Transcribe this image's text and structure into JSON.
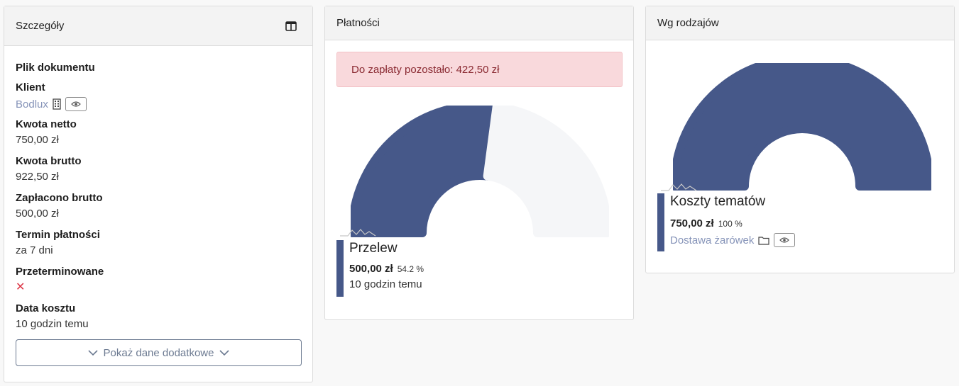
{
  "details": {
    "title": "Szczegóły",
    "file_label": "Plik dokumentu",
    "client_label": "Klient",
    "client_name": "Bodlux",
    "net_label": "Kwota netto",
    "net_value": "750,00 zł",
    "gross_label": "Kwota brutto",
    "gross_value": "922,50 zł",
    "paid_label": "Zapłacono brutto",
    "paid_value": "500,00 zł",
    "term_label": "Termin płatności",
    "term_value": "za 7 dni",
    "overdue_label": "Przeterminowane",
    "overdue_value": "✕",
    "date_label": "Data kosztu",
    "date_value": "10 godzin temu",
    "more_button": "Pokaż dane dodatkowe"
  },
  "payments": {
    "title": "Płatności",
    "alert": "Do zapłaty pozostało: 422,50 zł",
    "legend": {
      "name": "Przelew",
      "amount": "500,00 zł",
      "percent": "54.2 %",
      "time": "10 godzin temu"
    }
  },
  "types": {
    "title": "Wg rodzajów",
    "legend": {
      "name": "Koszty tematów",
      "amount": "750,00 zł",
      "percent": "100 %",
      "link": "Dostawa żarówek"
    }
  },
  "colors": {
    "accent": "#465889",
    "remaining": "#f5f6f8",
    "link": "#8593b8",
    "alert_bg": "#f9d9dc",
    "alert_text": "#8a2a32",
    "danger": "#dc3545"
  },
  "chart_data": [
    {
      "type": "pie",
      "categories": [
        "Przelew",
        ""
      ],
      "values": [
        500.0,
        422.5
      ]
    },
    {
      "type": "pie",
      "categories": [
        "Koszty tematów"
      ],
      "values": [
        750.0
      ]
    }
  ]
}
